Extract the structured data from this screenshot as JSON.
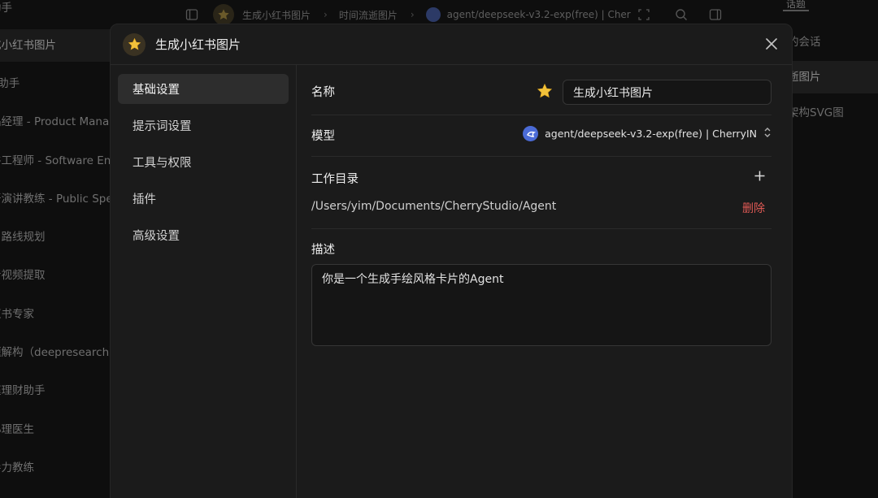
{
  "background": {
    "sidebar_items": [
      {
        "label": "助手",
        "active": false
      },
      {
        "label": "成小红书图片",
        "active": true
      },
      {
        "label": "A助手",
        "active": false
      },
      {
        "label": "品经理 - Product Manag",
        "active": false
      },
      {
        "label": "件工程师 - Software Eng",
        "active": false
      },
      {
        "label": "开演讲教练 - Public Spea",
        "active": false
      },
      {
        "label": "习路线规划",
        "active": false
      },
      {
        "label": "音视频提取",
        "active": false
      },
      {
        "label": "红书专家",
        "active": false
      },
      {
        "label": "题解构（deepresearch）",
        "active": false
      },
      {
        "label": "庭理财助手",
        "active": false
      },
      {
        "label": "心理医生",
        "active": false
      },
      {
        "label": "导力教练",
        "active": false
      }
    ],
    "breadcrumb": {
      "agent": "生成小红书图片",
      "topic": "时间流逝图片",
      "model": "agent/deepseek-v3.2-exp(free) | Cher"
    },
    "right_panel": {
      "tab": "话题",
      "items": [
        {
          "label": "的会话",
          "active": false
        },
        {
          "label": "逝图片",
          "active": true
        },
        {
          "label": "架构SVG图",
          "active": false
        }
      ]
    }
  },
  "modal": {
    "title": "生成小红书图片",
    "emoji_icon": "star-icon",
    "nav": [
      {
        "label": "基础设置",
        "active": true
      },
      {
        "label": "提示词设置",
        "active": false
      },
      {
        "label": "工具与权限",
        "active": false
      },
      {
        "label": "插件",
        "active": false
      },
      {
        "label": "高级设置",
        "active": false
      }
    ],
    "name": {
      "label": "名称",
      "value": "生成小红书图片"
    },
    "model": {
      "label": "模型",
      "value": "agent/deepseek-v3.2-exp(free) | CherryIN"
    },
    "workdir": {
      "label": "工作目录",
      "path": "/Users/yim/Documents/CherryStudio/Agent",
      "delete_label": "删除"
    },
    "description": {
      "label": "描述",
      "value": "你是一个生成手绘风格卡片的Agent"
    }
  },
  "colors": {
    "accent_danger": "#e05a55",
    "model_icon": "#4b6bd6",
    "star": "#f2c23b"
  }
}
